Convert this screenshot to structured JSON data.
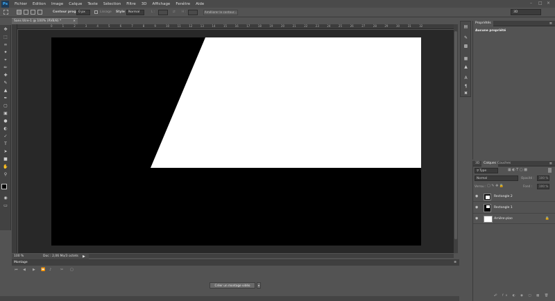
{
  "app": {
    "logo": "Ps"
  },
  "menu": [
    "Fichier",
    "Edition",
    "Image",
    "Calque",
    "Texte",
    "Sélection",
    "Filtre",
    "3D",
    "Affichage",
    "Fenêtre",
    "Aide"
  ],
  "options": {
    "contour_label": "Contour progr. :",
    "contour_value": "0 px",
    "lissage_label": "Lissage",
    "style_label": "Style :",
    "style_value": "Normal",
    "l_label": "L :",
    "h_label": "H :",
    "refine_button": "Améliorer le contour...",
    "workspace": "3D"
  },
  "document": {
    "tab_title": "Sans titre-1 @ 100% (RVB/8) *",
    "close": "×",
    "zoom": "100 %",
    "doc_info": "Doc : 2,06 Mo/3 octets",
    "ruler_marks": [
      "0",
      "1",
      "2",
      "3",
      "4",
      "5",
      "6",
      "7",
      "8",
      "9",
      "10",
      "11",
      "12",
      "13",
      "14",
      "15",
      "16",
      "17",
      "18",
      "19",
      "20",
      "21",
      "22",
      "23",
      "24",
      "25",
      "26",
      "27",
      "28",
      "29",
      "30",
      "31",
      "32"
    ],
    "canvas_bg": "#000000",
    "shape_color": "#ffffff"
  },
  "properties": {
    "tab": "Propriétés",
    "empty_text": "Aucune propriété"
  },
  "layers": {
    "tabs": [
      "3D",
      "Calques",
      "Couches"
    ],
    "filter_value": "Type",
    "blend_value": "Normal",
    "opacity_label": "Opacité :",
    "opacity_value": "100 %",
    "lock_label": "Verrou :",
    "fill_label": "Fond :",
    "fill_value": "100 %",
    "items": [
      {
        "name": "Rectangle 2"
      },
      {
        "name": "Rectangle 1"
      },
      {
        "name": "Arrière-plan"
      }
    ]
  },
  "timeline": {
    "title": "Montage",
    "create_button": "Créer un montage vidéo",
    "dropdown": "▾"
  }
}
